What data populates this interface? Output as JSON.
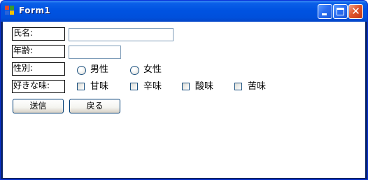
{
  "window": {
    "title": "Form1"
  },
  "labels": {
    "name": "氏名:",
    "age": "年齢:",
    "gender": "性別:",
    "taste": "好きな味:"
  },
  "gender_options": [
    "男性",
    "女性"
  ],
  "taste_options": [
    "甘味",
    "辛味",
    "酸味",
    "苦味"
  ],
  "buttons": {
    "send": "送信",
    "back": "戻る"
  },
  "colors": {
    "titlebar": "#0054e3",
    "close_button": "#e0542b",
    "input_border": "#7f9db9",
    "button_border": "#003c74"
  }
}
